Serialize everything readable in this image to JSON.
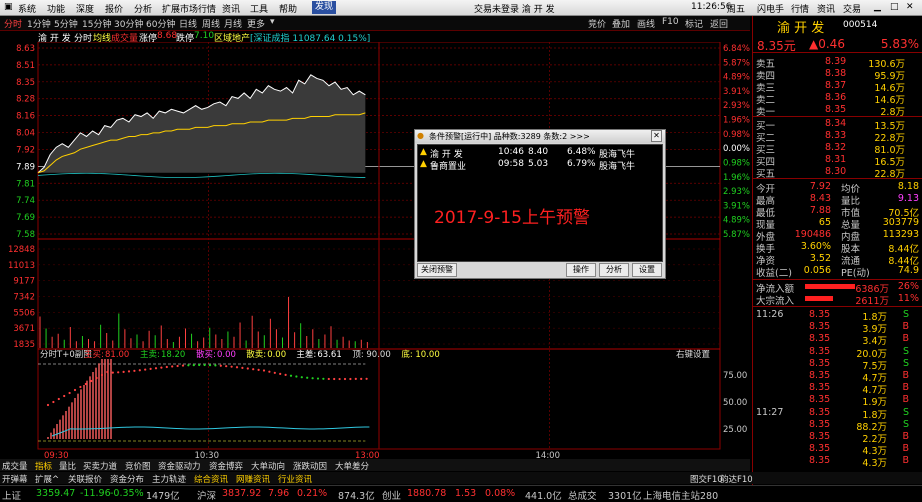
{
  "menu": {
    "items": [
      "系统",
      "功能",
      "深度",
      "报价",
      "分析",
      "扩展市场行情",
      "资讯",
      "工具",
      "帮助",
      "发现"
    ],
    "center": "交易未登录   渝 开 发",
    "clock": "11:26:56",
    "weekday": "周五",
    "right_btns": [
      "闪电手",
      "行情",
      "资讯",
      "交易"
    ]
  },
  "toolbar": {
    "items": [
      "分时",
      "1分钟",
      "5分钟",
      "15分钟",
      "30分钟",
      "60分钟",
      "日线",
      "周线",
      "月线",
      "更多"
    ],
    "right": [
      "竞价",
      "叠加",
      "画线",
      "F10",
      "标记",
      "返回"
    ]
  },
  "chart_header": {
    "stock": "渝 开 发",
    "mode": "分时",
    "avg": "均线",
    "vol": "成交量",
    "rise_label": "涨停",
    "rise_val": "8.68",
    "fall_label": "跌停",
    "fall_val": "7.10",
    "sector": "区域地产",
    "index": "[深证成指 11087.64 0.15%]"
  },
  "chart_data": [
    {
      "type": "line",
      "ylim": [
        7.56,
        8.63
      ],
      "prev_close": 7.92,
      "price_ticks": [
        "8.63",
        "8.51",
        "8.35",
        "8.28",
        "8.16",
        "8.04",
        "7.92",
        "7.89",
        "7.81",
        "7.74",
        "7.69",
        "7.58"
      ],
      "pct_ticks": [
        "6.84%",
        "5.87%",
        "4.89%",
        "3.91%",
        "2.93%",
        "1.96%",
        "0.98%",
        "0.00%",
        "0.98%",
        "1.96%",
        "2.93%",
        "3.91%",
        "4.89%",
        "5.87%"
      ],
      "x_ticks": [
        "09:30",
        "10:30",
        "13:00",
        "14:00"
      ],
      "series": [
        {
          "values": [
            7.92,
            7.95,
            8.02,
            8.06,
            8.08,
            8.06,
            8.1,
            8.14,
            8.12,
            8.15,
            8.13,
            8.18,
            8.17,
            8.21,
            8.22,
            8.2,
            8.24,
            8.23,
            8.25,
            8.22,
            8.26,
            8.25,
            8.27,
            8.26,
            8.25,
            8.27,
            8.29,
            8.27,
            8.28,
            8.3,
            8.31,
            8.29,
            8.34,
            8.33,
            8.36,
            8.33,
            8.38,
            8.36,
            8.4,
            8.38,
            8.37,
            8.39,
            8.36,
            8.43,
            8.41,
            8.46,
            8.44,
            8.43,
            8.4,
            8.42,
            8.38,
            8.39,
            8.35,
            8.37,
            8.35
          ]
        },
        {
          "values": [
            7.92,
            7.93,
            7.96,
            7.99,
            8.01,
            8.02,
            8.03,
            8.05,
            8.06,
            8.07,
            8.08,
            8.09,
            8.1,
            8.1,
            8.11,
            8.12,
            8.12,
            8.13,
            8.13,
            8.14,
            8.14,
            8.15,
            8.15,
            8.16,
            8.16,
            8.16,
            8.17,
            8.17,
            8.17,
            8.18,
            8.18,
            8.18,
            8.19,
            8.19,
            8.19,
            8.2,
            8.2,
            8.2,
            8.21,
            8.21,
            8.21,
            8.21,
            8.22,
            8.22,
            8.22,
            8.23,
            8.23,
            8.23,
            8.23,
            8.24,
            8.24,
            8.24,
            8.24,
            8.24,
            8.25
          ]
        }
      ]
    },
    {
      "type": "bar",
      "vol_ticks": [
        "12848",
        "11013",
        "9177",
        "7342",
        "5506",
        "3671",
        "1835"
      ],
      "values": [
        4200,
        2600,
        1500,
        1900,
        1100,
        2800,
        900,
        1600,
        1200,
        900,
        3100,
        2000,
        1000,
        4600,
        2500,
        1300,
        1800,
        900,
        2300,
        1700,
        3000,
        1200,
        800,
        1500,
        2600,
        1900,
        900,
        1400,
        2700,
        1800,
        1200,
        2200,
        1500,
        3400,
        1000,
        4300,
        2200,
        1700,
        3900,
        2500,
        1400,
        6800,
        2100,
        3300,
        1600,
        2500,
        1200,
        1800,
        2900,
        1100,
        1500,
        1000,
        900,
        1100,
        800
      ]
    },
    {
      "type": "area",
      "y_ticks": [
        "75.00",
        "50.00",
        "25.00"
      ],
      "indicator": "分时T+0副图",
      "legend": [
        {
          "label": "主买:",
          "val": "81.00",
          "color": "#ff3030"
        },
        {
          "label": "主卖:",
          "val": "18.20",
          "color": "#20d020"
        },
        {
          "label": "散买:",
          "val": "0.00",
          "color": "#ff40ff"
        },
        {
          "label": "散卖:",
          "val": "0.00",
          "color": "#ffff40"
        },
        {
          "label": "主差:",
          "val": "63.61",
          "color": "#ffffff"
        },
        {
          "label": "顶:",
          "val": "90.00",
          "color": "#dddddd"
        },
        {
          "label": "底:",
          "val": "10.00",
          "color": "#ffff40"
        }
      ],
      "right_label": "右键设置"
    }
  ],
  "dialog": {
    "title": "条件预警[运行中] 品种数:3289 条数:2  >>>",
    "rows": [
      {
        "name": "渝 开 发",
        "time": "10:46",
        "price": "8.40",
        "pct": "6.48%",
        "reason": "股海飞牛"
      },
      {
        "name": "鲁商置业",
        "time": "09:58",
        "price": "5.03",
        "pct": "6.79%",
        "reason": "股海飞牛"
      }
    ],
    "annotation": "2017-9-15上午预警",
    "close_btn": "关闭预警",
    "btns": [
      "操作",
      "分析",
      "设置"
    ]
  },
  "quote": {
    "name": "渝 开 发",
    "code": "000514",
    "price": "8.35元",
    "change": "▲0.46",
    "pct": "5.83%",
    "sells": [
      {
        "label": "卖五",
        "p": "8.39",
        "v": "130.6万"
      },
      {
        "label": "卖四",
        "p": "8.38",
        "v": "95.9万"
      },
      {
        "label": "卖三",
        "p": "8.37",
        "v": "14.6万"
      },
      {
        "label": "卖二",
        "p": "8.36",
        "v": "14.6万"
      },
      {
        "label": "卖一",
        "p": "8.35",
        "v": "2.8万"
      }
    ],
    "buys": [
      {
        "label": "买一",
        "p": "8.34",
        "v": "13.5万"
      },
      {
        "label": "买二",
        "p": "8.33",
        "v": "22.8万"
      },
      {
        "label": "买三",
        "p": "8.32",
        "v": "81.0万"
      },
      {
        "label": "买四",
        "p": "8.31",
        "v": "16.5万"
      },
      {
        "label": "买五",
        "p": "8.30",
        "v": "22.8万"
      }
    ],
    "stats": [
      [
        "今开",
        "7.92",
        "均价",
        "8.18"
      ],
      [
        "最高",
        "8.43",
        "量比",
        "9.13"
      ],
      [
        "最低",
        "7.88",
        "市值",
        "70.5亿"
      ],
      [
        "现量",
        "65",
        "总量",
        "303779"
      ],
      [
        "外盘",
        "190486",
        "内盘",
        "113293"
      ],
      [
        "换手",
        "3.60%",
        "股本",
        "8.44亿"
      ],
      [
        "净资",
        "3.52",
        "流通",
        "8.44亿"
      ],
      [
        "收益(二)",
        "0.056",
        "PE(动)",
        "74.9"
      ]
    ],
    "flows": [
      {
        "label": "净流入额",
        "v": "6386万",
        "p": "26%"
      },
      {
        "label": "大宗流入",
        "v": "2611万",
        "p": "11%"
      }
    ],
    "ticks": [
      {
        "t": "11:26",
        "p": "8.35",
        "v": "1.8万",
        "d": "S"
      },
      {
        "t": "",
        "p": "8.35",
        "v": "3.9万",
        "d": "B"
      },
      {
        "t": "",
        "p": "8.35",
        "v": "3.4万",
        "d": "B"
      },
      {
        "t": "",
        "p": "8.35",
        "v": "20.0万",
        "d": "S"
      },
      {
        "t": "",
        "p": "8.35",
        "v": "7.5万",
        "d": "S"
      },
      {
        "t": "",
        "p": "8.35",
        "v": "4.7万",
        "d": "B"
      },
      {
        "t": "",
        "p": "8.35",
        "v": "4.7万",
        "d": "B"
      },
      {
        "t": "",
        "p": "8.35",
        "v": "1.9万",
        "d": "B"
      },
      {
        "t": "11:27",
        "p": "8.35",
        "v": "1.8万",
        "d": "S"
      },
      {
        "t": "",
        "p": "8.35",
        "v": "88.2万",
        "d": "S"
      },
      {
        "t": "",
        "p": "8.35",
        "v": "2.2万",
        "d": "B"
      },
      {
        "t": "",
        "p": "8.35",
        "v": "4.3万",
        "d": "B"
      },
      {
        "t": "",
        "p": "8.35",
        "v": "4.3万",
        "d": "B"
      }
    ]
  },
  "bottom_tabs": [
    "成交量",
    "指标",
    "量比",
    "买卖力道",
    "竞价图",
    "资金驱动力",
    "资金博弈",
    "大单动向",
    "涨跌动因",
    "大单差分"
  ],
  "bottom_strip": [
    "开弹幕",
    "扩展^",
    "关联报价",
    "资金分布",
    "主力轨迹",
    "综合资讯",
    "网赚资讯",
    "行业资讯"
  ],
  "bottom_right": [
    "图交F10",
    "韵达F10"
  ],
  "ticker": [
    {
      "t": "上证",
      "c": "#c8c8c8"
    },
    {
      "t": "3359.47",
      "c": "#20d020"
    },
    {
      "t": "-11.96",
      "c": "#20d020"
    },
    {
      "t": "-0.35%",
      "c": "#20d020"
    },
    {
      "t": "1479亿",
      "c": "#c8c8c8"
    },
    {
      "t": "沪深",
      "c": "#c8c8c8"
    },
    {
      "t": "3837.92",
      "c": "#ff3030"
    },
    {
      "t": "7.96",
      "c": "#ff3030"
    },
    {
      "t": "0.21%",
      "c": "#ff3030"
    },
    {
      "t": "874.3亿",
      "c": "#c8c8c8"
    },
    {
      "t": "创业",
      "c": "#c8c8c8"
    },
    {
      "t": "1880.78",
      "c": "#ff3030"
    },
    {
      "t": "1.53",
      "c": "#ff3030"
    },
    {
      "t": "0.08%",
      "c": "#ff3030"
    },
    {
      "t": "441.0亿",
      "c": "#c8c8c8"
    },
    {
      "t": "总成交",
      "c": "#c8c8c8"
    },
    {
      "t": "3301亿",
      "c": "#c8c8c8"
    },
    {
      "t": "上海电信主站280",
      "c": "#c8c8c8"
    }
  ]
}
